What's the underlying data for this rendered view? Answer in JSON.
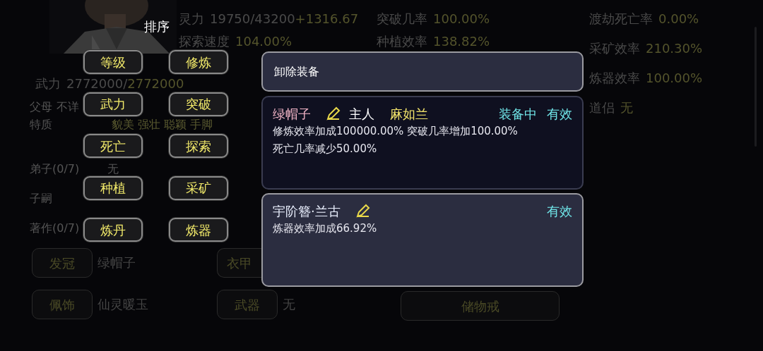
{
  "stats": [
    {
      "label": "灵力",
      "value": "19750/43200",
      "bonus": "+1316.67"
    },
    {
      "label": "探索速度",
      "value": "104.00%"
    },
    {
      "label": "突破几率",
      "value": "100.00%"
    },
    {
      "label": "种植效率",
      "value": "138.82%"
    },
    {
      "label": "渡劫死亡率",
      "value": "0.00%"
    },
    {
      "label": "采矿效率",
      "value": "210.30%"
    },
    {
      "label": "炼器效率",
      "value": "100.00%"
    },
    {
      "label": "道侣",
      "value": "无"
    },
    {
      "label": "武力",
      "value": "2772000/",
      "bonus": "2772000"
    }
  ],
  "attributes": [
    {
      "label": "父母",
      "value": "不详"
    },
    {
      "label": "特质",
      "value": "貌美 强壮 聪颖 手脚"
    },
    {
      "label": "弟子(0/7)",
      "value": "无"
    },
    {
      "label": "子嗣"
    },
    {
      "label": "著作(0/7)"
    }
  ],
  "equipment_slots": [
    {
      "slot": "发冠",
      "item": "绿帽子"
    },
    {
      "slot": "衣甲"
    },
    {
      "slot": "佩饰",
      "item": "仙灵暖玉"
    },
    {
      "slot": "武器",
      "item": "无"
    }
  ],
  "storage_button": "储物戒",
  "sort_menu": {
    "title": "排序",
    "options": [
      "等级",
      "修炼",
      "武力",
      "突破",
      "死亡",
      "探索",
      "种植",
      "采矿",
      "炼丹",
      "炼器"
    ]
  },
  "popup": {
    "action": "卸除装备",
    "items": [
      {
        "name": "绿帽子",
        "owner_label": "主人",
        "owner": "麻如兰",
        "status": "装备中",
        "validity": "有效",
        "effects": [
          "修炼效率加成100000.00% 突破几率增加100.00%",
          "死亡几率减少50.00%"
        ]
      },
      {
        "name": "宇阶簪·兰古",
        "validity": "有效",
        "effects": [
          "炼器效率加成66.92%"
        ]
      }
    ]
  }
}
